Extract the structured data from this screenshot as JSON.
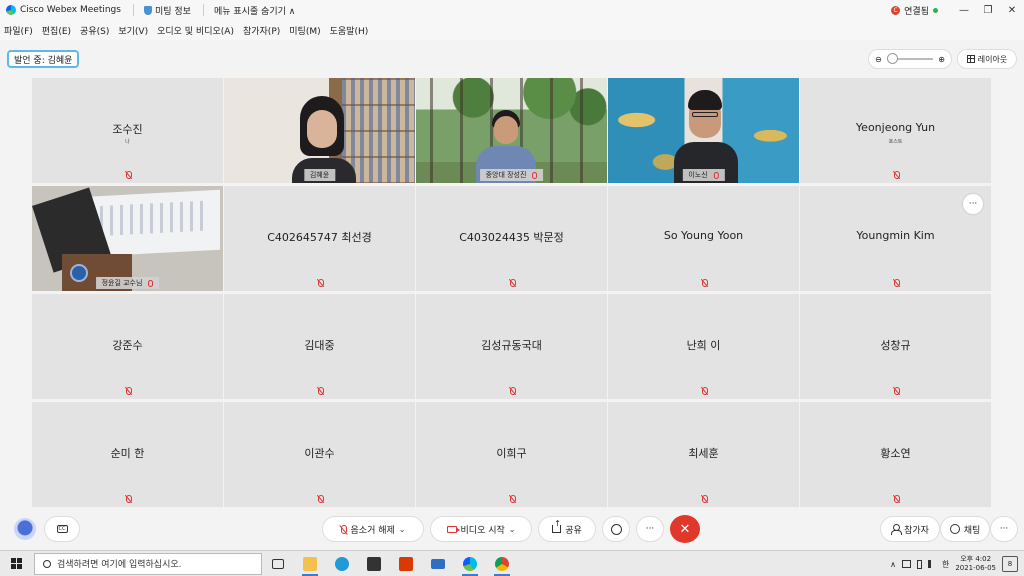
{
  "titlebar": {
    "app_title": "Cisco Webex Meetings",
    "meeting_info": "미팅 정보",
    "menu_toggle": "메뉴 표시줄 숨기기 ∧",
    "status": "연결됨",
    "rec_letter": "C",
    "window_controls": [
      "—",
      "❐",
      "✕"
    ]
  },
  "menubar": [
    "파일(F)",
    "편집(E)",
    "공유(S)",
    "보기(V)",
    "오디오 및 비디오(A)",
    "참가자(P)",
    "미팅(M)",
    "도움말(H)"
  ],
  "speaking": "발언 중: 김혜윤",
  "zoom": {
    "minus": "⊖",
    "plus": "⊕",
    "level": 0
  },
  "layout_button": "레이아웃",
  "tiles": [
    {
      "name": "조수진",
      "sub": "나"
    },
    {
      "video_label": "김혜윤",
      "scene": "room"
    },
    {
      "video_label": "중앙대 장성진",
      "scene": "forest"
    },
    {
      "video_label": "이노신",
      "scene": "map"
    },
    {
      "name": "Yeonjeong Yun",
      "sub": "호스트"
    },
    {
      "video_label": "정윤길 교수님",
      "scene": "class"
    },
    {
      "name": "C402645747 최선경"
    },
    {
      "name": "C403024435 박문정"
    },
    {
      "name": "So Young Yoon"
    },
    {
      "name": "Youngmin Kim",
      "more": "···"
    },
    {
      "name": "강준수"
    },
    {
      "name": "김대중"
    },
    {
      "name": "김성규동국대"
    },
    {
      "name": "난희 이"
    },
    {
      "name": "성창규"
    },
    {
      "name": "순미 한"
    },
    {
      "name": "이관수"
    },
    {
      "name": "이희구"
    },
    {
      "name": "최세훈"
    },
    {
      "name": "황소연"
    }
  ],
  "controls": {
    "mute": "음소거 해제",
    "video": "비디오 시작",
    "share": "공유",
    "more": "···",
    "end": "✕",
    "participants": "참가자",
    "chat": "채팅",
    "right_more": "···",
    "chevron": "⌄",
    "cc": "CC"
  },
  "taskbar": {
    "search_placeholder": "검색하려면 여기에 입력하십시오.",
    "tray_chevron": "∧",
    "ime": "한",
    "time": "오후 4:02",
    "date": "2021-06-05",
    "notifications": "8",
    "apps": [
      "task-view",
      "file-explorer",
      "edge",
      "store",
      "office",
      "mail",
      "webex",
      "chrome"
    ]
  },
  "colors": {
    "tile_bg": "#e3e3e3",
    "end_call": "#e0392b",
    "speaking_border": "#5fb9e8",
    "muted_red": "#dd3333"
  }
}
